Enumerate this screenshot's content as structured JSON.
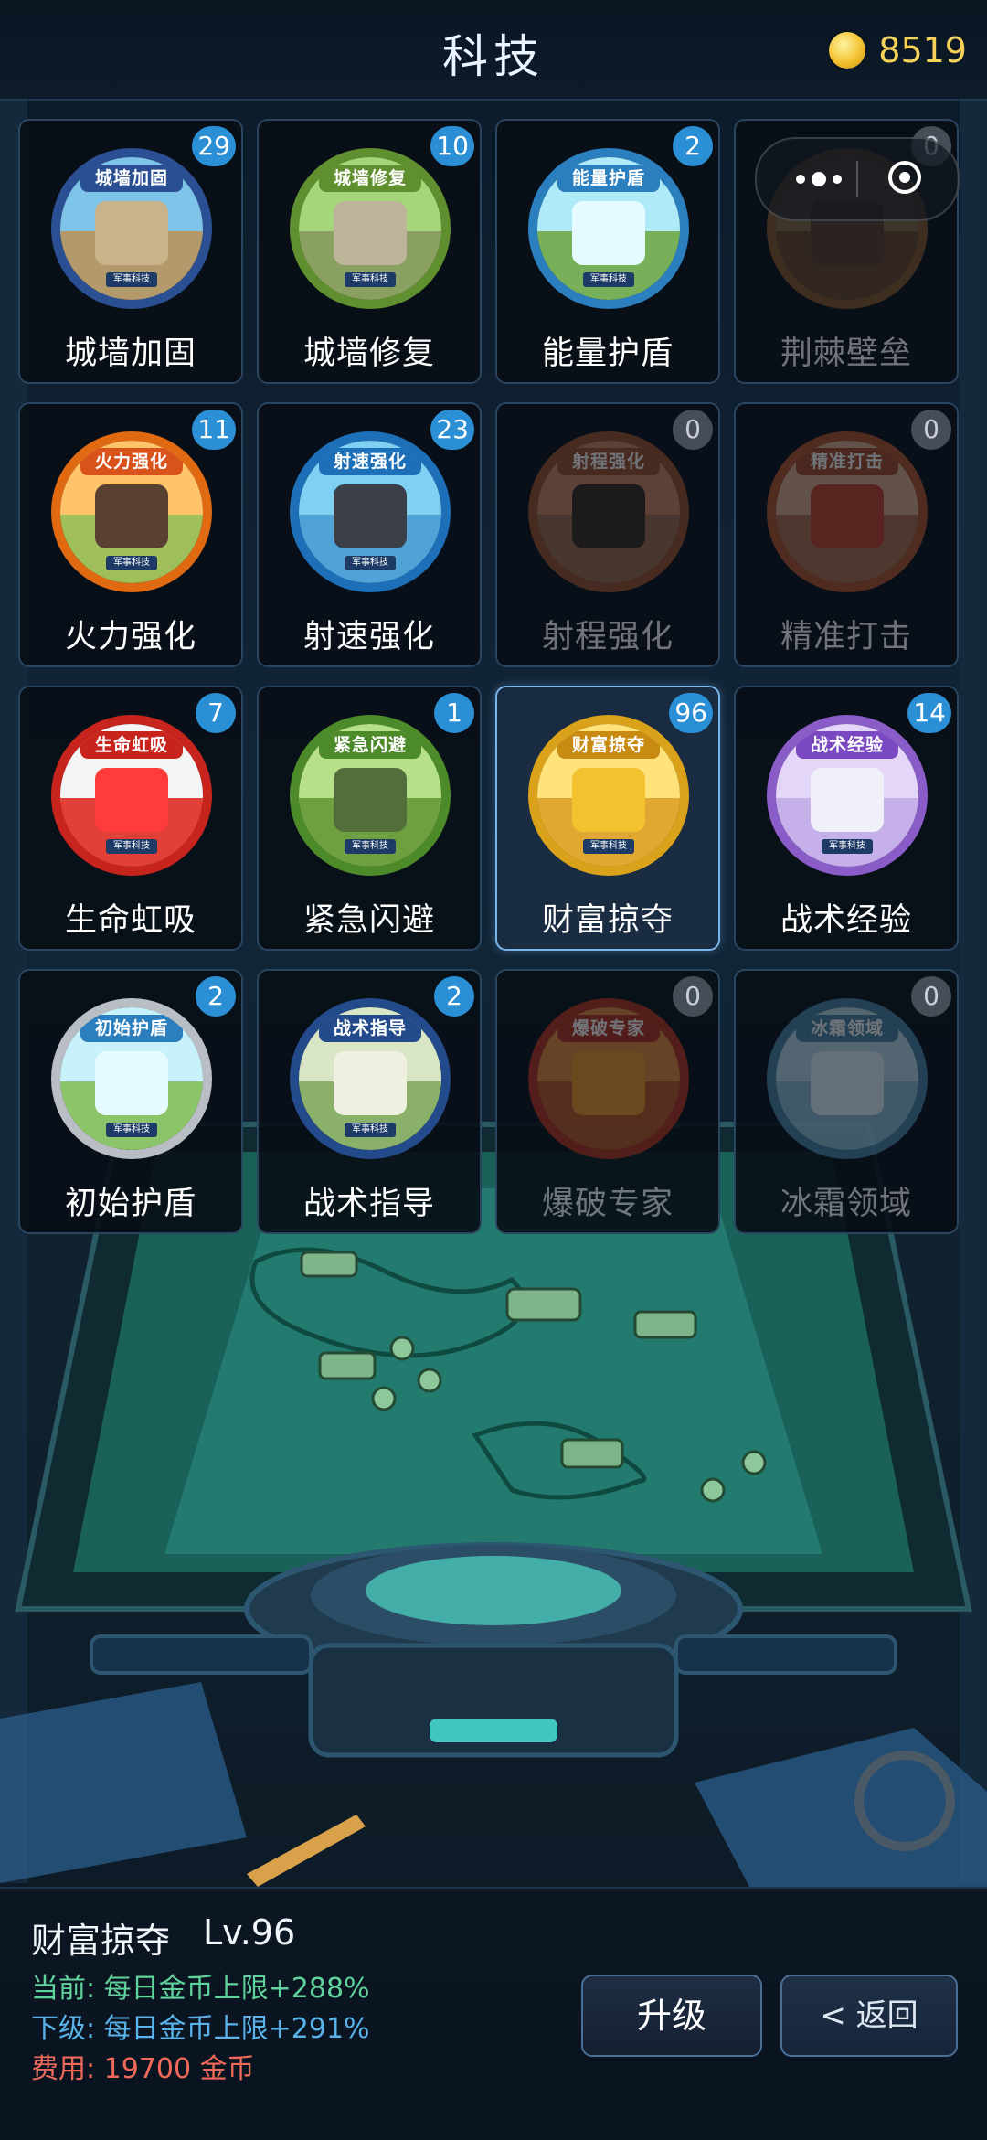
{
  "header": {
    "title": "科技",
    "coins": "8519"
  },
  "techs": [
    {
      "name": "城墙加固",
      "level": "29",
      "ribbon": "城墙加固",
      "plaque": "军事科技",
      "theme": "wall",
      "locked": false
    },
    {
      "name": "城墙修复",
      "level": "10",
      "ribbon": "城墙修复",
      "plaque": "军事科技",
      "theme": "repair",
      "locked": false
    },
    {
      "name": "能量护盾",
      "level": "2",
      "ribbon": "能量护盾",
      "plaque": "军事科技",
      "theme": "shield",
      "locked": false
    },
    {
      "name": "荆棘壁垒",
      "level": "0",
      "ribbon": "",
      "plaque": "",
      "theme": "thorn",
      "locked": true
    },
    {
      "name": "火力强化",
      "level": "11",
      "ribbon": "火力强化",
      "plaque": "军事科技",
      "theme": "fire",
      "locked": false
    },
    {
      "name": "射速强化",
      "level": "23",
      "ribbon": "射速强化",
      "plaque": "军事科技",
      "theme": "speed",
      "locked": false
    },
    {
      "name": "射程强化",
      "level": "0",
      "ribbon": "射程强化",
      "plaque": "",
      "theme": "range",
      "locked": true
    },
    {
      "name": "精准打击",
      "level": "0",
      "ribbon": "精准打击",
      "plaque": "",
      "theme": "precise",
      "locked": true
    },
    {
      "name": "生命虹吸",
      "level": "7",
      "ribbon": "生命虹吸",
      "plaque": "军事科技",
      "theme": "life",
      "locked": false
    },
    {
      "name": "紧急闪避",
      "level": "1",
      "ribbon": "紧急闪避",
      "plaque": "军事科技",
      "theme": "dodge",
      "locked": false
    },
    {
      "name": "财富掠夺",
      "level": "96",
      "ribbon": "财富掠夺",
      "plaque": "军事科技",
      "theme": "wealth",
      "locked": false,
      "selected": true
    },
    {
      "name": "战术经验",
      "level": "14",
      "ribbon": "战术经验",
      "plaque": "军事科技",
      "theme": "exp",
      "locked": false
    },
    {
      "name": "初始护盾",
      "level": "2",
      "ribbon": "初始护盾",
      "plaque": "军事科技",
      "theme": "initshield",
      "locked": false
    },
    {
      "name": "战术指导",
      "level": "2",
      "ribbon": "战术指导",
      "plaque": "军事科技",
      "theme": "guide",
      "locked": false
    },
    {
      "name": "爆破专家",
      "level": "0",
      "ribbon": "爆破专家",
      "plaque": "",
      "theme": "blast",
      "locked": true
    },
    {
      "name": "冰霜领域",
      "level": "0",
      "ribbon": "冰霜领域",
      "plaque": "",
      "theme": "frost",
      "locked": true
    }
  ],
  "detail": {
    "name": "财富掠夺",
    "level": "Lv.96",
    "current": "当前: 每日金币上限+288%",
    "next": "下级: 每日金币上限+291%",
    "cost": "费用: 19700 金币"
  },
  "buttons": {
    "upgrade": "升级",
    "back": "< 返回"
  },
  "colors": {
    "accent": "#2b8fd6",
    "gold": "#f6d259",
    "current": "#5fd39b",
    "next": "#59b3ea",
    "cost": "#f06a5a"
  }
}
